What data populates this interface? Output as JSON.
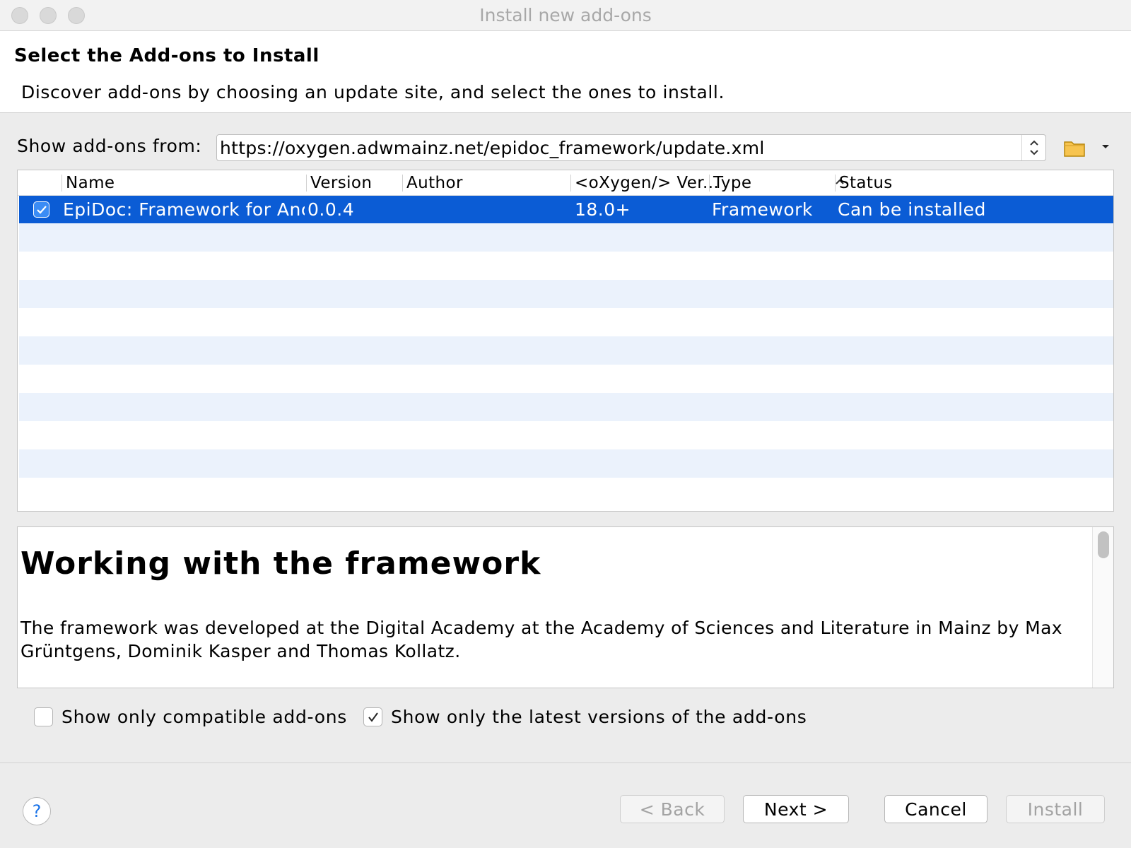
{
  "window": {
    "title": "Install new add-ons"
  },
  "header": {
    "title": "Select the Add-ons to Install",
    "description": "Discover add-ons by choosing an update site, and select the ones to install."
  },
  "source": {
    "label": "Show add-ons from:",
    "url": "https://oxygen.adwmainz.net/epidoc_framework/update.xml",
    "folder_icon": "folder-icon",
    "menu_icon": "dropdown-arrow-icon"
  },
  "table": {
    "columns": [
      "Name",
      "Version",
      "Author",
      "<oXygen/> Ver...",
      "Type",
      "Status"
    ],
    "sorted_column": "Type",
    "rows": [
      {
        "checked": true,
        "name": "EpiDoc: Framework for Anci...",
        "version": "0.0.4",
        "author": "",
        "oxygen_version": "18.0+",
        "type": "Framework",
        "status": "Can be installed"
      }
    ]
  },
  "details": {
    "heading": "Working with the framework",
    "text": "The framework was developed at the Digital Academy at the Academy of Sciences and Literature in Mainz by Max Grüntgens, Dominik Kasper and Thomas Kollatz."
  },
  "options": {
    "compatible_only": {
      "label": "Show only compatible add-ons",
      "checked": false
    },
    "latest_only": {
      "label": "Show only the latest versions of the add-ons",
      "checked": true
    }
  },
  "buttons": {
    "help": "?",
    "back": "< Back",
    "next": "Next >",
    "cancel": "Cancel",
    "install": "Install"
  },
  "colors": {
    "selection": "#0b5cd5",
    "stripe": "#ebf2fc",
    "accent": "#3b8cf5"
  }
}
